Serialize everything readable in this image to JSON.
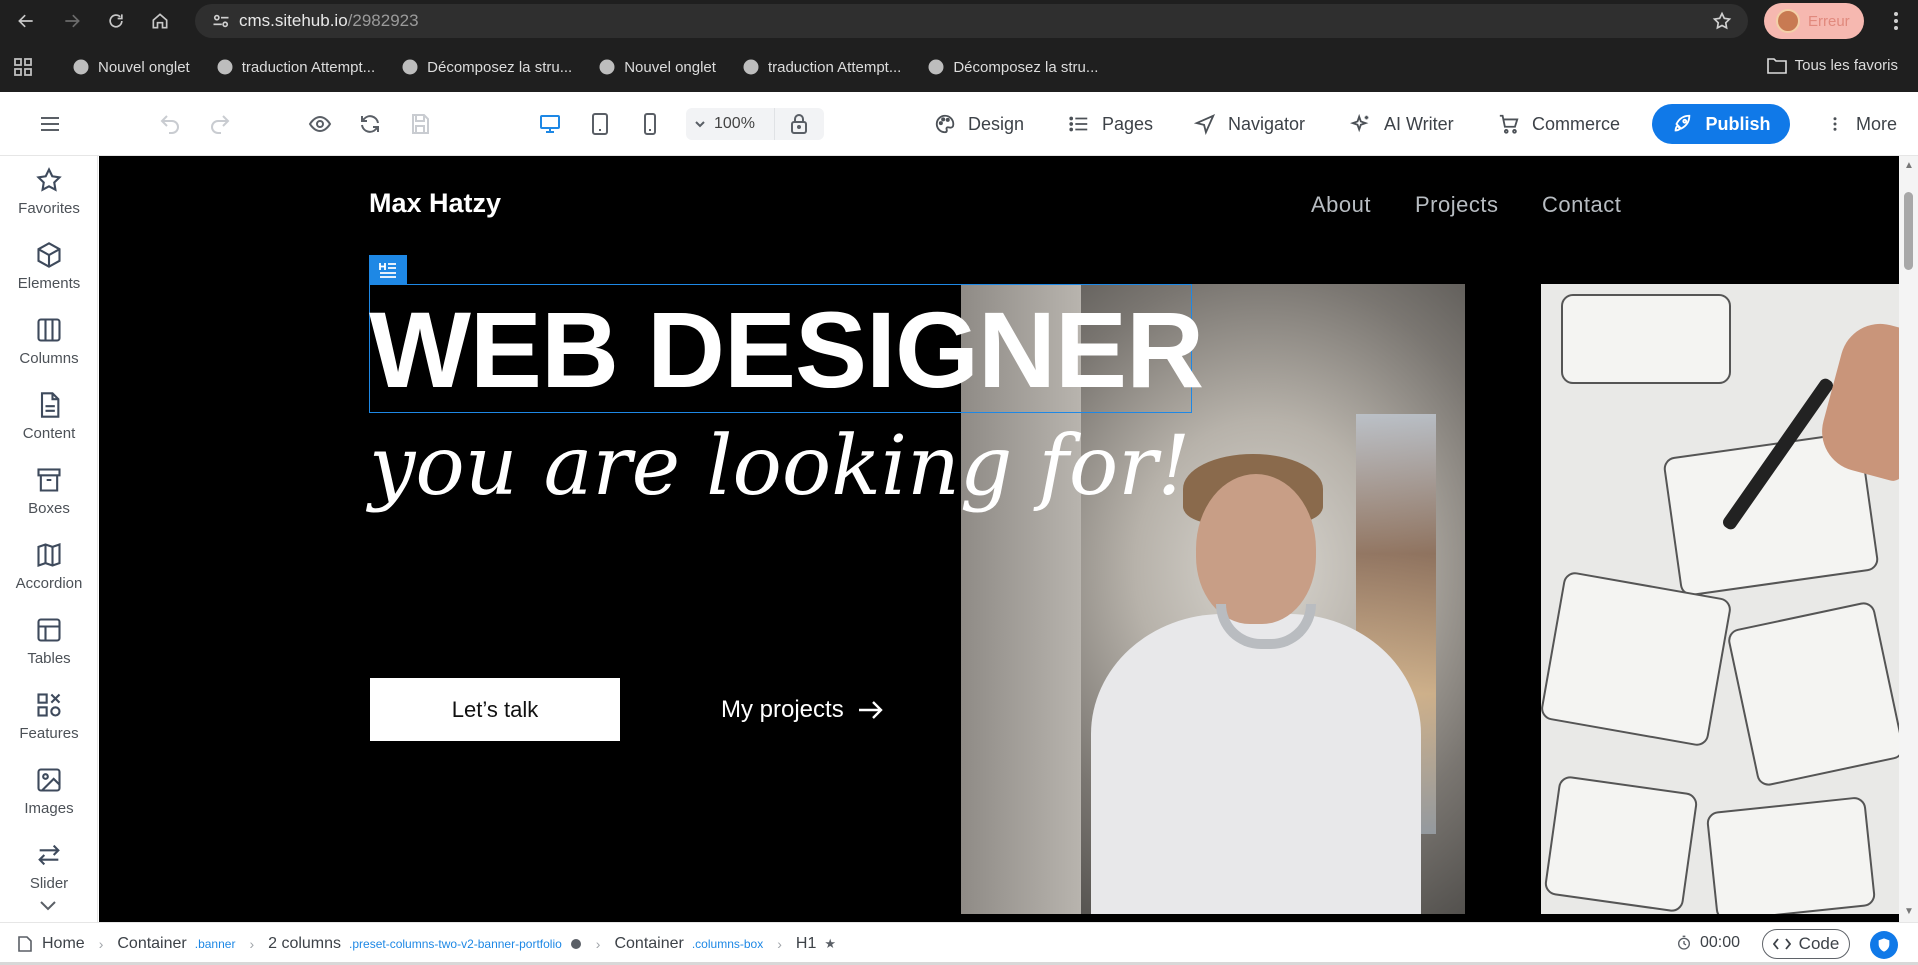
{
  "browser": {
    "url_host": "cms.sitehub.io",
    "url_path": "/2982923",
    "profile_label": "Erreur",
    "bookmarks": [
      "Nouvel onglet",
      "traduction Attempt...",
      "Décomposez la stru...",
      "Nouvel onglet",
      "traduction Attempt...",
      "Décomposez la stru..."
    ],
    "all_bookmarks": "Tous les favoris"
  },
  "toolbar": {
    "zoom": "100%",
    "menu": {
      "design": "Design",
      "pages": "Pages",
      "navigator": "Navigator",
      "ai_writer": "AI Writer",
      "commerce": "Commerce",
      "more": "More"
    },
    "publish": "Publish"
  },
  "sidebar": {
    "items": [
      "Favorites",
      "Elements",
      "Columns",
      "Content",
      "Boxes",
      "Accordion",
      "Tables",
      "Features",
      "Images",
      "Slider"
    ]
  },
  "site": {
    "logo": "Max Hatzy",
    "nav": [
      "About",
      "Projects",
      "Contact"
    ],
    "headline": "WEB DESIGNER",
    "subheadline": "you are looking for!",
    "cta_primary": "Let’s talk",
    "cta_secondary": "My projects"
  },
  "status": {
    "breadcrumb": [
      {
        "label": "Home",
        "cls": ""
      },
      {
        "label": "Container",
        "cls": ".banner"
      },
      {
        "label": "2 columns",
        "cls": ".preset-columns-two-v2-banner-portfolio"
      },
      {
        "label": "Container",
        "cls": ".columns-box"
      },
      {
        "label": "H1",
        "cls": ""
      }
    ],
    "timer": "00:00",
    "code": "Code"
  },
  "colors": {
    "accent": "#1079e8",
    "selection": "#1e88e5",
    "canvas_bg": "#000000"
  }
}
